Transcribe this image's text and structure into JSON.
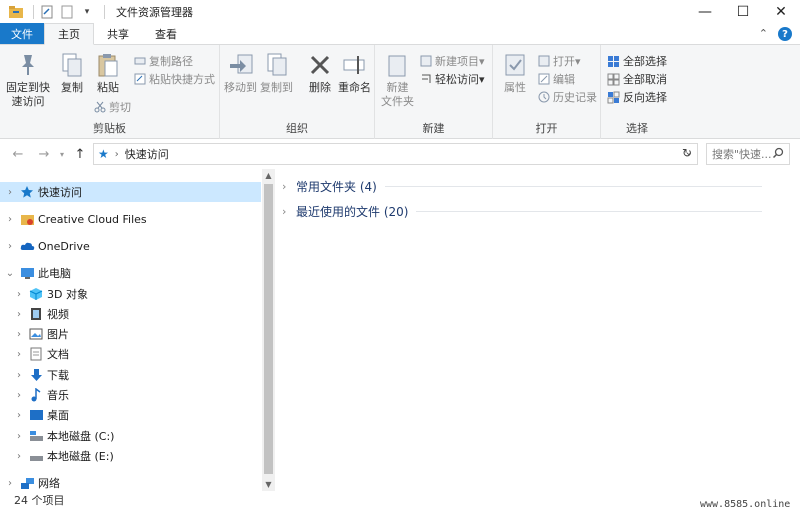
{
  "window": {
    "title": "文件资源管理器",
    "controls": {
      "minimize": "—",
      "maximize": "☐",
      "close": "✕"
    }
  },
  "tabs": {
    "file": "文件",
    "items": [
      "主页",
      "共享",
      "查看"
    ],
    "active": "主页",
    "expand": "⌃",
    "help": "?"
  },
  "ribbon": {
    "clipboard": {
      "label": "剪贴板",
      "pin": "固定到快速访问",
      "pin_l1": "固定到快",
      "pin_l2": "速访问",
      "copy": "复制",
      "paste": "粘贴",
      "copy_path": "复制路径",
      "paste_shortcut": "粘贴快捷方式",
      "cut": "剪切"
    },
    "organize": {
      "label": "组织",
      "move_to": "移动到",
      "copy_to": "复制到",
      "delete": "删除",
      "rename": "重命名"
    },
    "new": {
      "label": "新建",
      "new_folder_l1": "新建",
      "new_folder_l2": "文件夹",
      "new_item": "新建项目",
      "easy_access": "轻松访问"
    },
    "open": {
      "label": "打开",
      "properties": "属性",
      "open": "打开",
      "edit": "编辑",
      "history": "历史记录"
    },
    "select": {
      "label": "选择",
      "select_all": "全部选择",
      "select_none": "全部取消",
      "invert": "反向选择"
    }
  },
  "address": {
    "path": "快速访问",
    "search_placeholder": "搜索\"快速..."
  },
  "nav": {
    "items": [
      {
        "label": "快速访问",
        "icon": "star-icon"
      },
      {
        "label": "Creative Cloud Files",
        "icon": "creative-cloud-folder-icon"
      },
      {
        "label": "OneDrive",
        "icon": "cloud-icon"
      },
      {
        "label": "此电脑",
        "icon": "computer-icon"
      },
      {
        "label": "3D 对象",
        "icon": "cube-icon"
      },
      {
        "label": "视频",
        "icon": "video-icon"
      },
      {
        "label": "图片",
        "icon": "picture-icon"
      },
      {
        "label": "文档",
        "icon": "document-icon"
      },
      {
        "label": "下载",
        "icon": "download-icon"
      },
      {
        "label": "音乐",
        "icon": "music-icon"
      },
      {
        "label": "桌面",
        "icon": "desktop-icon"
      },
      {
        "label": "本地磁盘 (C:)",
        "icon": "drive-icon"
      },
      {
        "label": "本地磁盘 (E:)",
        "icon": "drive-icon"
      },
      {
        "label": "网络",
        "icon": "network-icon"
      }
    ]
  },
  "content": {
    "sections": [
      {
        "label": "常用文件夹 (4)"
      },
      {
        "label": "最近使用的文件 (20)"
      }
    ]
  },
  "status": {
    "count": "24 个项目"
  },
  "watermark": "www.8585.online",
  "colors": {
    "accent": "#1979ca",
    "selected": "#cce8ff",
    "ribbon_bg": "#f5f6f7"
  }
}
